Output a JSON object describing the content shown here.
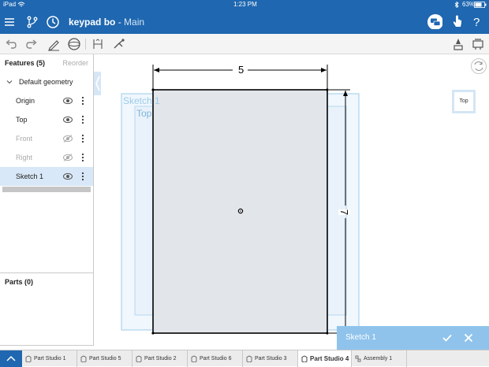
{
  "status": {
    "device": "iPad",
    "wifi_icon": "wifi-icon",
    "time": "1:23 PM",
    "bluetooth_icon": "bluetooth-icon",
    "battery": "63%"
  },
  "titlebar": {
    "doc_name": "keypad bo",
    "separator": " - ",
    "workspace": "Main"
  },
  "features": {
    "header": "Features (5)",
    "reorder": "Reorder",
    "group": "Default geometry",
    "items": [
      {
        "label": "Origin",
        "hidden": false,
        "selected": false
      },
      {
        "label": "Top",
        "hidden": false,
        "selected": false
      },
      {
        "label": "Front",
        "hidden": true,
        "selected": false
      },
      {
        "label": "Right",
        "hidden": true,
        "selected": false
      },
      {
        "label": "Sketch 1",
        "hidden": false,
        "selected": true
      }
    ]
  },
  "parts": {
    "header": "Parts (0)"
  },
  "canvas": {
    "plane_label": "Sketch 1",
    "top_plane_label": "Top",
    "dim_width": "5",
    "dim_height": "7",
    "view_cube_label": "Top"
  },
  "sketch_dialog": {
    "title": "Sketch 1",
    "accept_icon": "check-icon",
    "cancel_icon": "close-icon"
  },
  "tabs": [
    {
      "label": "Part Studio 1",
      "active": false
    },
    {
      "label": "Part Studio 5",
      "active": false
    },
    {
      "label": "Part Studio 2",
      "active": false
    },
    {
      "label": "Part Studio 6",
      "active": false
    },
    {
      "label": "Part Studio 3",
      "active": false
    },
    {
      "label": "Part Studio 4",
      "active": true
    },
    {
      "label": "Assembly 1",
      "active": false
    }
  ],
  "colors": {
    "brand": "#1f67b0",
    "selection": "#d9e8f8",
    "dialog": "#8fc3ec",
    "plane": "#9ccbea"
  }
}
